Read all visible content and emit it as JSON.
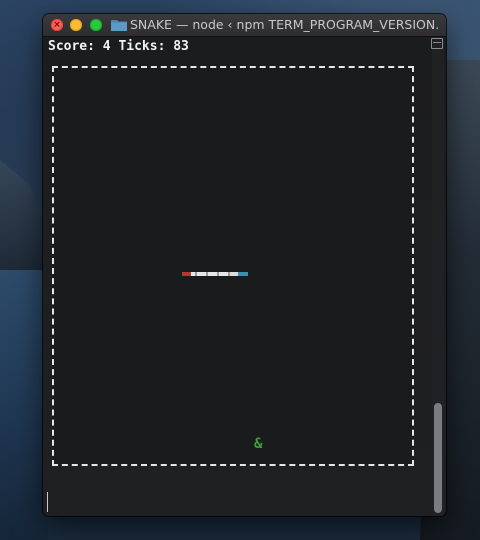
{
  "window": {
    "title": "SNAKE — node ‹ npm TERM_PROGRAM_VERSION..."
  },
  "terminal": {
    "status_line": "Score: 4 Ticks: 83",
    "food_glyph": "&"
  },
  "game": {
    "score": 4,
    "ticks": 83
  },
  "colors": {
    "food": "#3aa336",
    "snake_head": "#b03a2e",
    "snake_body": "#d8d8d8",
    "snake_tail": "#3b8fb0",
    "board_border": "#e6e6e6"
  }
}
